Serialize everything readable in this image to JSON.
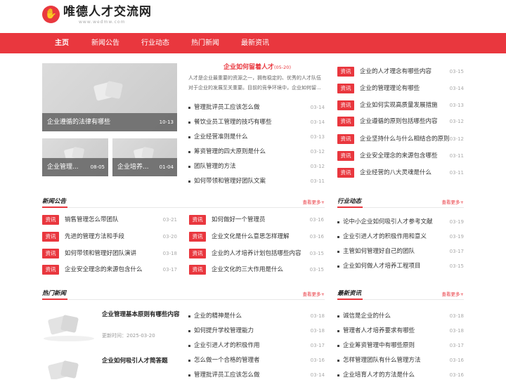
{
  "logo": {
    "title": "唯德人才交流网",
    "domain": "www.wedmw.com",
    "icon": "hand-logo-icon"
  },
  "nav": [
    "主页",
    "新闻公告",
    "行业动态",
    "热门新闻",
    "最新资讯"
  ],
  "colors": {
    "accent": "#e9373e",
    "badge": "#e9373e",
    "caption_bg": "#666666"
  },
  "slider": {
    "main": {
      "title": "企业遵循的法律有哪些",
      "date": "10-13"
    },
    "thumbs": [
      {
        "title": "企业管理...",
        "date": "08-05"
      },
      {
        "title": "企业培养...",
        "date": "01-04"
      }
    ]
  },
  "featured": {
    "title": "企业如何留着人才",
    "date": "(05-20)",
    "summary": "人才是企业最重要的资源之一，拥有稳定的、优秀的人才队伍对于企业的发展至关重要。目前的竞争环境中，企业如何留..."
  },
  "mid_list": [
    {
      "t": "管理批评员工应该怎么做",
      "d": "03-14"
    },
    {
      "t": "餐饮业员工管理的技巧有哪些",
      "d": "03-14"
    },
    {
      "t": "企业经营准则是什么",
      "d": "03-13"
    },
    {
      "t": "筹资管理的四大原则是什么",
      "d": "03-12"
    },
    {
      "t": "团队管理的方法",
      "d": "03-12"
    },
    {
      "t": "如何带领和管理好团队文案",
      "d": "03-11"
    }
  ],
  "right_top": {
    "badge": "资讯",
    "items": [
      {
        "t": "企业的人才理念有哪些内容",
        "d": "03-15"
      },
      {
        "t": "企业的管理理论有哪些",
        "d": "03-14"
      },
      {
        "t": "企业如何实现高质量发展措施",
        "d": "03-13"
      },
      {
        "t": "企业遵循的原则包括哪些内容",
        "d": "03-12"
      },
      {
        "t": "企业坚持什么与什么相结合的原则",
        "d": "03-12"
      },
      {
        "t": "企业安全理念的来源包含哪些",
        "d": "03-11"
      },
      {
        "t": "企业经营的八大灵魂是什么",
        "d": "03-11"
      }
    ]
  },
  "news": {
    "header": "新闻公告",
    "more": "查看更多+",
    "badge": "资讯",
    "col1": [
      {
        "t": "销售管理怎么带团队",
        "d": "03-21"
      },
      {
        "t": "先进的管理方法和手段",
        "d": "03-20"
      },
      {
        "t": "如何带领和管理好团队演讲",
        "d": "03-18"
      },
      {
        "t": "企业安全理念的来源包含什么",
        "d": "03-17"
      }
    ],
    "col2": [
      {
        "t": "如何做好一个管理员",
        "d": "03-16"
      },
      {
        "t": "企业文化是什么意思怎样理解",
        "d": "03-16"
      },
      {
        "t": "企业的人才培养计划包括哪些内容",
        "d": "03-15"
      },
      {
        "t": "企业文化的三大作用是什么",
        "d": "03-15"
      }
    ]
  },
  "industry": {
    "header": "行业动态",
    "more": "查看更多+",
    "items": [
      {
        "t": "论中小企业如何吸引人才参考文献",
        "d": "03-19"
      },
      {
        "t": "企业引进人才的积极作用和意义",
        "d": "03-19"
      },
      {
        "t": "主管如何管理好自己的团队",
        "d": "03-17"
      },
      {
        "t": "企业如何做人才培养工程项目",
        "d": "03-15"
      }
    ]
  },
  "hot": {
    "header": "热门新闻",
    "more": "查看更多+",
    "time_label": "更新时间：",
    "cards": [
      {
        "title": "企业管理基本原则有哪些内容",
        "time": "2025-03-20"
      },
      {
        "title": "企业如何吸引人才简答题",
        "time": ""
      }
    ],
    "list": [
      {
        "t": "企业的精神是什么",
        "d": "03-18"
      },
      {
        "t": "如何提升学校管理能力",
        "d": "03-18"
      },
      {
        "t": "企业引进人才的积极作用",
        "d": "03-17"
      },
      {
        "t": "怎么做一个合格的管理者",
        "d": "03-16"
      },
      {
        "t": "管理批评员工应该怎么做",
        "d": "03-14"
      }
    ]
  },
  "latest": {
    "header": "最新资讯",
    "more": "查看更多+",
    "items": [
      {
        "t": "诚信是企业的什么",
        "d": "03-18"
      },
      {
        "t": "管理者人才培养要求有哪些",
        "d": "03-18"
      },
      {
        "t": "企业筹资管理中有哪些原则",
        "d": "03-17"
      },
      {
        "t": "怎样管理团队有什么管理方法",
        "d": "03-16"
      },
      {
        "t": "企业培育人才的方法是什么",
        "d": "03-16"
      }
    ]
  }
}
